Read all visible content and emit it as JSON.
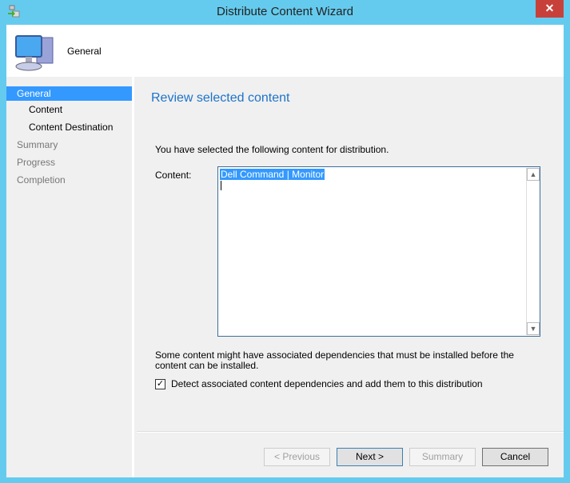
{
  "window": {
    "title": "Distribute Content Wizard",
    "close_label": "✕"
  },
  "header": {
    "page_title": "General"
  },
  "sidebar": {
    "items": [
      {
        "label": "General",
        "state": "active"
      },
      {
        "label": "Content",
        "state": "sub"
      },
      {
        "label": "Content Destination",
        "state": "sub"
      },
      {
        "label": "Summary",
        "state": "pending"
      },
      {
        "label": "Progress",
        "state": "pending"
      },
      {
        "label": "Completion",
        "state": "pending"
      }
    ]
  },
  "main": {
    "heading": "Review selected content",
    "intro": "You have selected the following content for distribution.",
    "content_label": "Content:",
    "content_items": [
      "Dell Command | Monitor"
    ],
    "dependencies_note": "Some content might have associated dependencies that must be installed before the content can be installed.",
    "detect_dependencies": {
      "label": "Detect associated content dependencies and add them to this distribution",
      "checked": true,
      "mark": "✓"
    }
  },
  "buttons": {
    "previous": "< Previous",
    "next": "Next >",
    "summary": "Summary",
    "cancel": "Cancel"
  },
  "colors": {
    "titlebar": "#65cbee",
    "accent": "#3399ff",
    "heading": "#1e73c8",
    "close": "#c7413a"
  }
}
